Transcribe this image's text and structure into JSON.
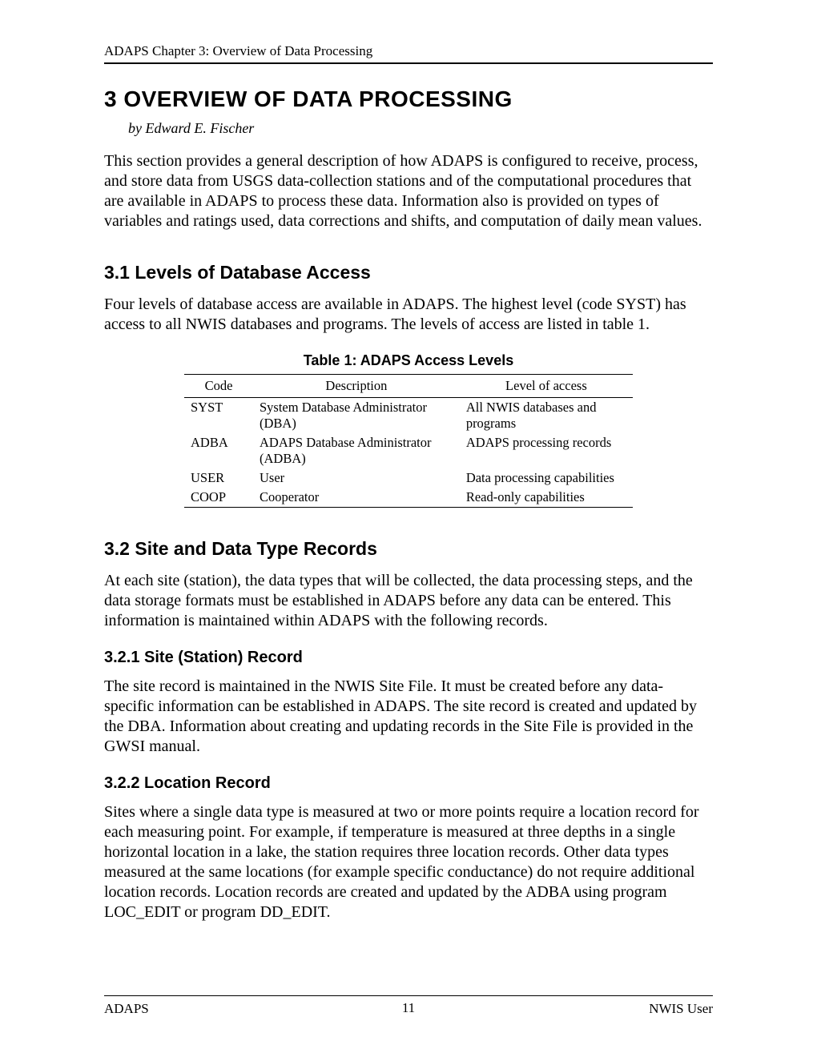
{
  "header": {
    "running": "ADAPS Chapter 3:  Overview of Data Processing"
  },
  "chapter": {
    "number_title": "3  OVERVIEW OF DATA PROCESSING",
    "byline": "by Edward E. Fischer",
    "intro": "This section provides a general description of how ADAPS is configured to receive, process, and store data from USGS data-collection stations and of the computational procedures that are available in ADAPS to process these data.  Information also is provided on types of variables and ratings used, data corrections and shifts, and computation of daily mean values."
  },
  "s31": {
    "heading": "3.1  Levels of Database Access",
    "para": "Four levels of database access are available in ADAPS.  The highest level (code SYST) has access to all NWIS databases and programs.  The levels of access are listed in table 1."
  },
  "table1": {
    "caption": "Table 1: ADAPS Access Levels",
    "head": {
      "c1": "Code",
      "c2": "Description",
      "c3": "Level of access"
    },
    "rows": [
      {
        "c1": "SYST",
        "c2": "System Database Administrator (DBA)",
        "c3": "All NWIS databases and programs"
      },
      {
        "c1": "ADBA",
        "c2": "ADAPS Database Administrator (ADBA)",
        "c3": "ADAPS processing records"
      },
      {
        "c1": "USER",
        "c2": "User",
        "c3": "Data processing capabilities"
      },
      {
        "c1": "COOP",
        "c2": "Cooperator",
        "c3": "Read-only capabilities"
      }
    ]
  },
  "s32": {
    "heading": "3.2  Site and Data Type Records",
    "para": "At each site (station), the data types that will be collected, the data processing steps, and the data storage formats must be established in ADAPS before any data can be entered.  This information is maintained within ADAPS with the following records."
  },
  "s321": {
    "heading": "3.2.1   Site (Station) Record",
    "para": "The site record is maintained in the NWIS Site File.  It must be created before any data-specific information can be established in ADAPS.  The site record is created and updated by the DBA.  Information about creating and updating records in the Site File is provided in the GWSI manual."
  },
  "s322": {
    "heading": "3.2.2   Location Record",
    "para": "Sites where a single data type is measured at two or more points require a location record for each measuring point.  For example, if temperature is measured at three depths in a single horizontal location in a lake, the station requires three location records.  Other data types measured at the same locations (for example specific conductance) do not require additional location records.  Location records are created and updated by the ADBA using program LOC_EDIT or program DD_EDIT."
  },
  "footer": {
    "left": "ADAPS",
    "center": "11",
    "right": "NWIS User"
  }
}
